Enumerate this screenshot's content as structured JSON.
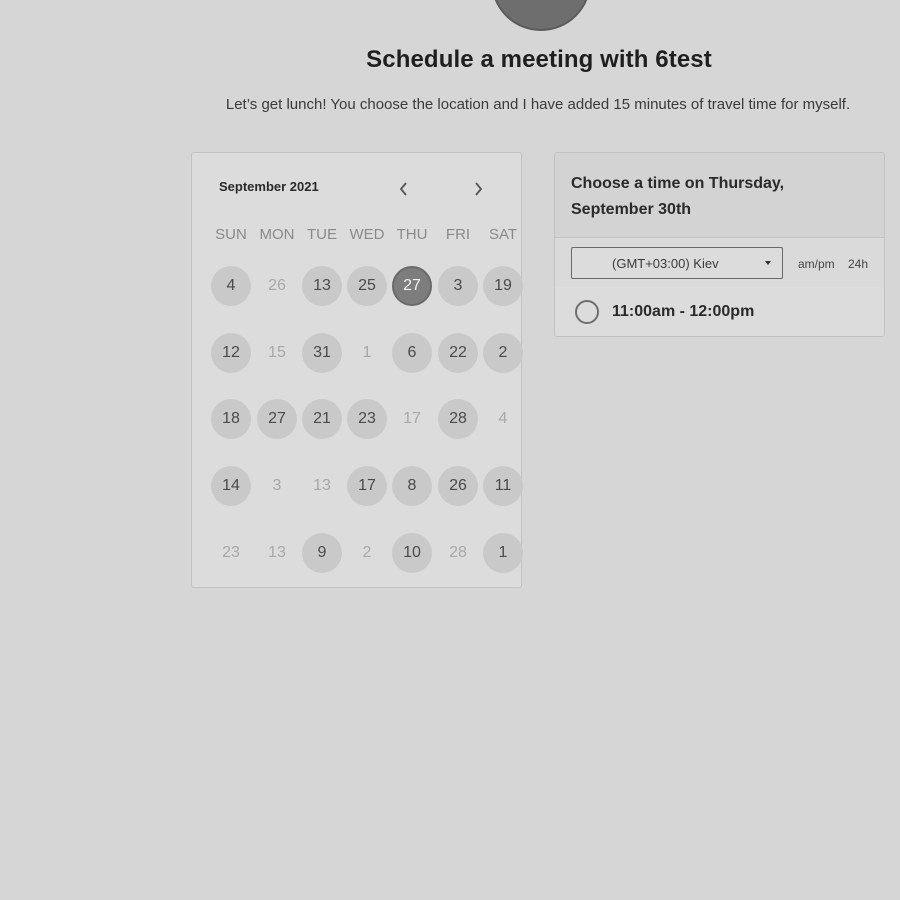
{
  "header": {
    "title": "Schedule a meeting with 6test",
    "subtitle": "Let’s get lunch! You choose the location and I have added 15 minutes of travel time for myself."
  },
  "calendar": {
    "month_label": "September 2021",
    "prev_icon": "chevron-left-icon",
    "next_icon": "chevron-right-icon",
    "weekdays": [
      "SUN",
      "MON",
      "TUE",
      "WED",
      "THU",
      "FRI",
      "SAT"
    ],
    "weeks": [
      [
        {
          "label": "4",
          "state": "avail"
        },
        {
          "label": "26",
          "state": "dim"
        },
        {
          "label": "13",
          "state": "avail"
        },
        {
          "label": "25",
          "state": "avail"
        },
        {
          "label": "27",
          "state": "selected"
        },
        {
          "label": "3",
          "state": "avail"
        },
        {
          "label": "19",
          "state": "avail"
        }
      ],
      [
        {
          "label": "12",
          "state": "avail"
        },
        {
          "label": "15",
          "state": "dim"
        },
        {
          "label": "31",
          "state": "avail"
        },
        {
          "label": "1",
          "state": "dim"
        },
        {
          "label": "6",
          "state": "avail"
        },
        {
          "label": "22",
          "state": "avail"
        },
        {
          "label": "2",
          "state": "avail"
        }
      ],
      [
        {
          "label": "18",
          "state": "avail"
        },
        {
          "label": "27",
          "state": "avail"
        },
        {
          "label": "21",
          "state": "avail"
        },
        {
          "label": "23",
          "state": "avail"
        },
        {
          "label": "17",
          "state": "dim"
        },
        {
          "label": "28",
          "state": "avail"
        },
        {
          "label": "4",
          "state": "dim"
        }
      ],
      [
        {
          "label": "14",
          "state": "avail"
        },
        {
          "label": "3",
          "state": "dim"
        },
        {
          "label": "13",
          "state": "dim"
        },
        {
          "label": "17",
          "state": "avail"
        },
        {
          "label": "8",
          "state": "avail"
        },
        {
          "label": "26",
          "state": "avail"
        },
        {
          "label": "11",
          "state": "avail"
        }
      ],
      [
        {
          "label": "23",
          "state": "dim"
        },
        {
          "label": "13",
          "state": "dim"
        },
        {
          "label": "9",
          "state": "avail"
        },
        {
          "label": "2",
          "state": "dim"
        },
        {
          "label": "10",
          "state": "avail"
        },
        {
          "label": "28",
          "state": "dim"
        },
        {
          "label": "1",
          "state": "avail"
        }
      ]
    ]
  },
  "times": {
    "heading": "Choose a time on Thursday, September 30th",
    "timezone": "(GMT+03:00) Kiev",
    "format_ampm": "am/pm",
    "format_24h": "24h",
    "slots": [
      {
        "label": "11:00am - 12:00pm"
      }
    ]
  },
  "colors": {
    "background": "#d6d6d6",
    "selected_day": "#7d7d7d",
    "available_day": "#c9c9c9"
  }
}
